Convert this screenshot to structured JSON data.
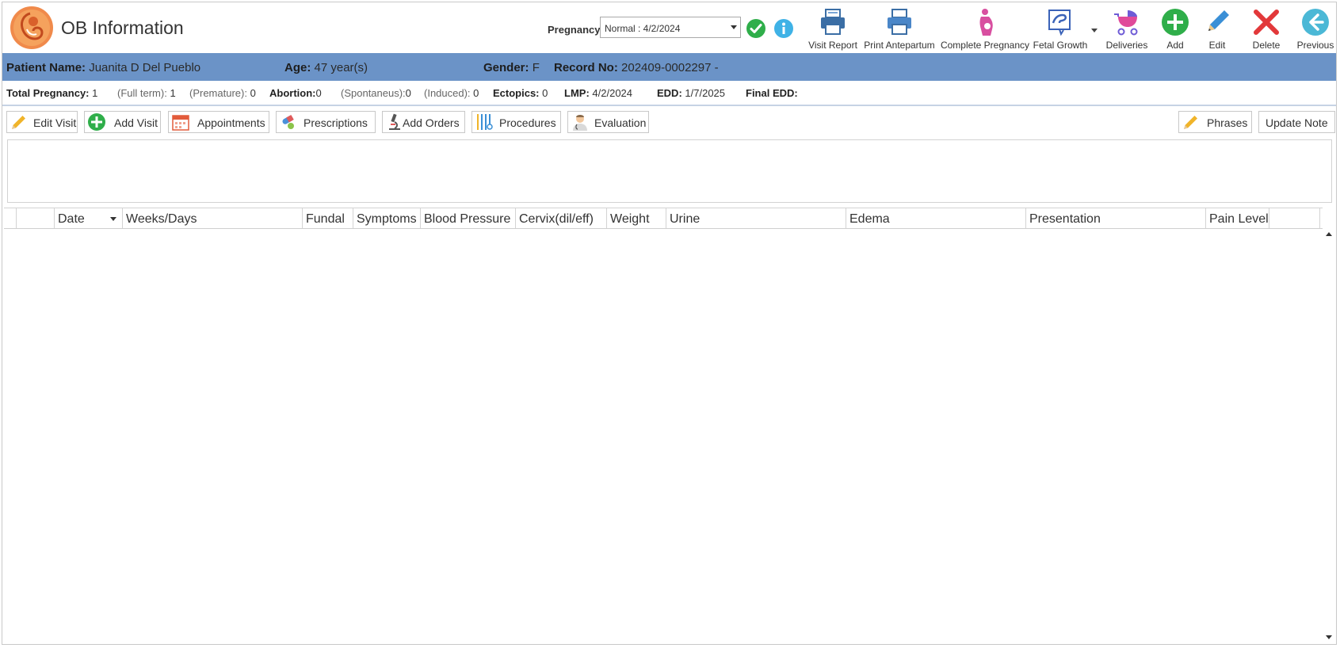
{
  "app": {
    "title": "OB Information"
  },
  "pregnancy": {
    "label": "Pregnancy:",
    "selected": "Normal : 4/2/2024"
  },
  "toolbar": {
    "visit_report": "Visit Report",
    "print_antepartum": "Print Antepartum",
    "complete_pregnancy": "Complete Pregnancy",
    "fetal_growth": "Fetal Growth",
    "deliveries": "Deliveries",
    "add": "Add",
    "edit": "Edit",
    "delete": "Delete",
    "previous": "Previous"
  },
  "patient": {
    "name_label": "Patient Name:",
    "name": "Juanita D Del Pueblo",
    "age_label": "Age:",
    "age": "47 year(s)",
    "gender_label": "Gender:",
    "gender": "F",
    "record_label": "Record No:",
    "record": "202409-0002297 -"
  },
  "summary": {
    "total_label": "Total Pregnancy:",
    "total": "1",
    "fullterm_label": "(Full term):",
    "fullterm": "1",
    "premature_label": "(Premature):",
    "premature": "0",
    "abortion_label": "Abortion:",
    "abortion": "0",
    "spontaneus_label": "(Spontaneus):",
    "spontaneus": "0",
    "induced_label": "(Induced):",
    "induced": "0",
    "ectopics_label": "Ectopics:",
    "ectopics": "0",
    "lmp_label": "LMP:",
    "lmp": "4/2/2024",
    "edd_label": "EDD:",
    "edd": "1/7/2025",
    "final_edd_label": "Final EDD:",
    "final_edd": ""
  },
  "actions": {
    "edit_visit": "Edit Visit",
    "add_visit": "Add Visit",
    "appointments": "Appointments",
    "prescriptions": "Prescriptions",
    "add_orders": "Add Orders",
    "procedures": "Procedures",
    "evaluation": "Evaluation",
    "phrases": "Phrases",
    "update_note": "Update Note"
  },
  "grid": {
    "columns": [
      "Date",
      "Weeks/Days",
      "Fundal",
      "Symptoms",
      "Blood Pressure",
      "Cervix(dil/eff)",
      "Weight",
      "Urine",
      "Edema",
      "Presentation",
      "Pain Level"
    ],
    "rows": []
  },
  "colors": {
    "band": "#6b93c7",
    "accent_green": "#2fae4a",
    "accent_red": "#e2383a",
    "accent_blue": "#3a8fd6"
  }
}
